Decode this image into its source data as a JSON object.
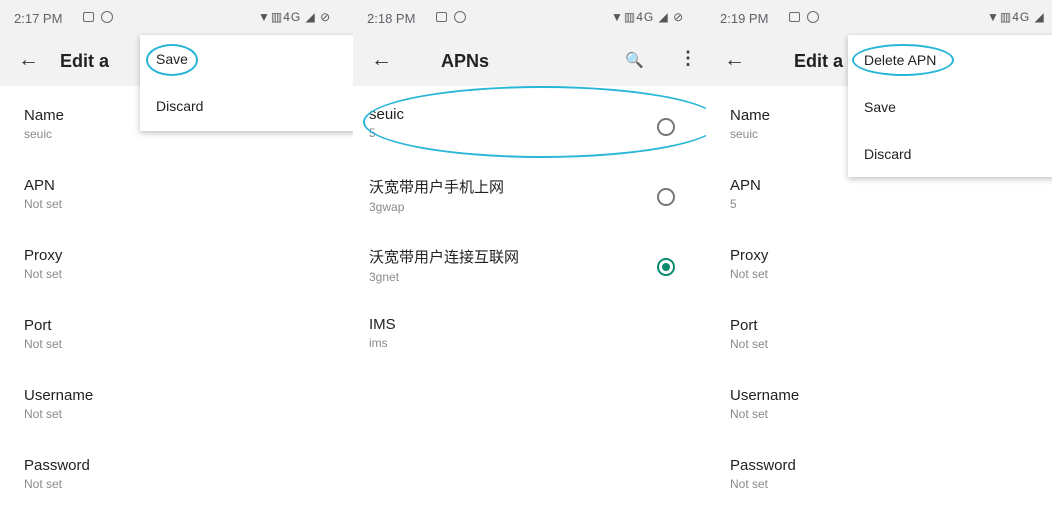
{
  "colors": {
    "accent": "#0a8a6f",
    "highlight": "#29b6d6",
    "bar": "#f2f2f2"
  },
  "panel1": {
    "status": {
      "time": "2:17 PM",
      "system": "▼▥4G ◢ ⊘"
    },
    "appbar": {
      "back_icon": "←",
      "title": "Edit a"
    },
    "menu": [
      "Save",
      "Discard"
    ],
    "fields": [
      {
        "title": "Name",
        "summary": "seuic"
      },
      {
        "title": "APN",
        "summary": "Not set"
      },
      {
        "title": "Proxy",
        "summary": "Not set"
      },
      {
        "title": "Port",
        "summary": "Not set"
      },
      {
        "title": "Username",
        "summary": "Not set"
      },
      {
        "title": "Password",
        "summary": "Not set"
      }
    ]
  },
  "panel2": {
    "status": {
      "time": "2:18 PM",
      "system": "▼▥4G ◢ ⊘"
    },
    "appbar": {
      "back_icon": "←",
      "title": "APNs",
      "search_icon": "🔍",
      "more_icon": "⋮"
    },
    "apns": [
      {
        "name": "seuic",
        "apn": "5",
        "selected": false
      },
      {
        "name": "沃宽带用户手机上网",
        "apn": "3gwap",
        "selected": false
      },
      {
        "name": "沃宽带用户连接互联网",
        "apn": "3gnet",
        "selected": true
      },
      {
        "name": "IMS",
        "apn": "ims",
        "selected": false
      }
    ]
  },
  "panel3": {
    "status": {
      "time": "2:19 PM",
      "system": "▼▥4G ◢"
    },
    "appbar": {
      "back_icon": "←",
      "title": "Edit a"
    },
    "menu": [
      "Delete APN",
      "Save",
      "Discard"
    ],
    "fields": [
      {
        "title": "Name",
        "summary": "seuic"
      },
      {
        "title": "APN",
        "summary": "5"
      },
      {
        "title": "Proxy",
        "summary": "Not set"
      },
      {
        "title": "Port",
        "summary": "Not set"
      },
      {
        "title": "Username",
        "summary": "Not set"
      },
      {
        "title": "Password",
        "summary": "Not set"
      }
    ]
  }
}
